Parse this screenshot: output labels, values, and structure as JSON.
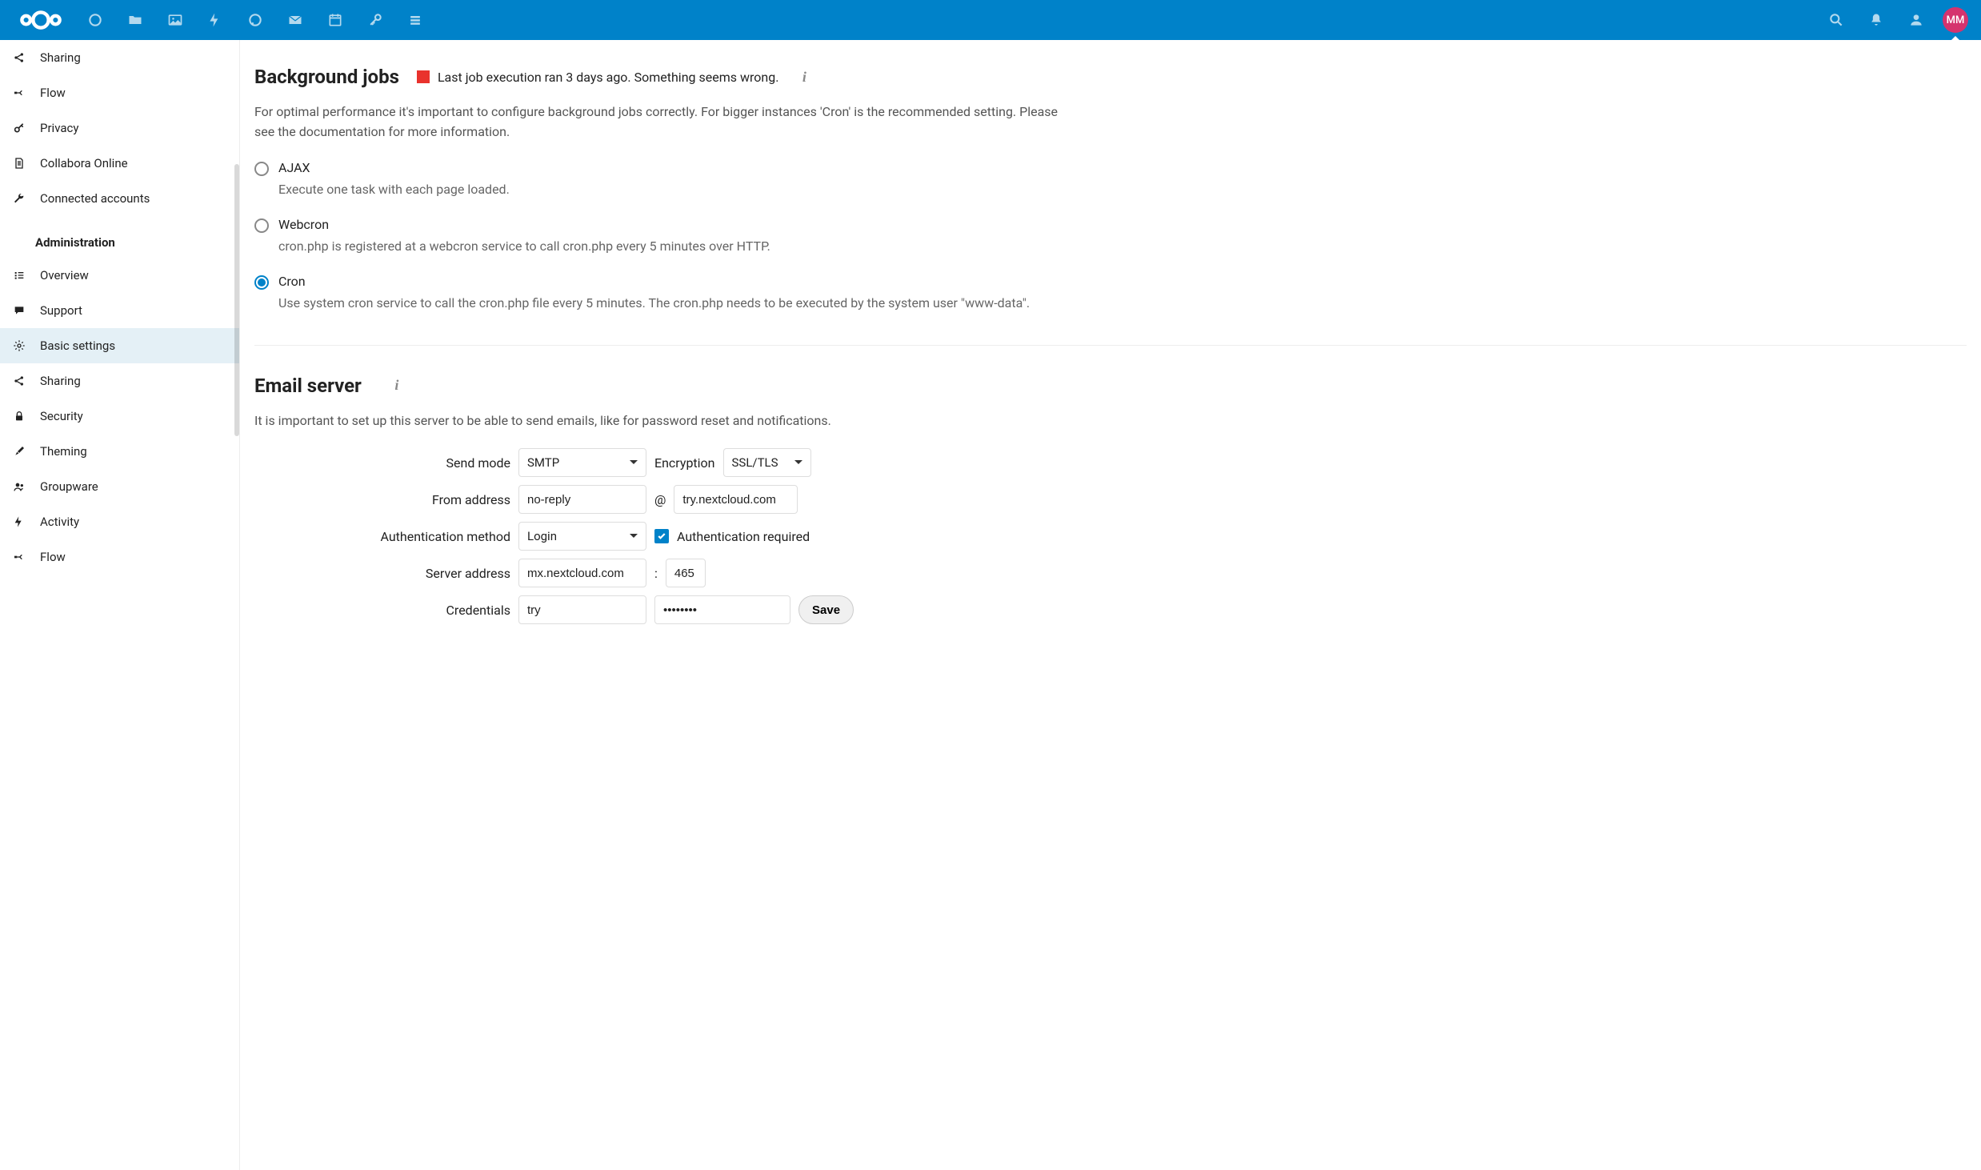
{
  "avatar_initials": "MM",
  "sidebar": {
    "personal": [
      {
        "id": "sharing",
        "label": "Sharing",
        "icon": "share"
      },
      {
        "id": "flow",
        "label": "Flow",
        "icon": "flow"
      },
      {
        "id": "privacy",
        "label": "Privacy",
        "icon": "key"
      },
      {
        "id": "collabora",
        "label": "Collabora Online",
        "icon": "doc"
      },
      {
        "id": "connected",
        "label": "Connected accounts",
        "icon": "wrench"
      }
    ],
    "admin_heading": "Administration",
    "admin": [
      {
        "id": "overview",
        "label": "Overview",
        "icon": "list"
      },
      {
        "id": "support",
        "label": "Support",
        "icon": "comment"
      },
      {
        "id": "basic",
        "label": "Basic settings",
        "icon": "gear",
        "active": true
      },
      {
        "id": "sharing-admin",
        "label": "Sharing",
        "icon": "share"
      },
      {
        "id": "security",
        "label": "Security",
        "icon": "lock"
      },
      {
        "id": "theming",
        "label": "Theming",
        "icon": "brush"
      },
      {
        "id": "groupware",
        "label": "Groupware",
        "icon": "group"
      },
      {
        "id": "activity",
        "label": "Activity",
        "icon": "bolt"
      },
      {
        "id": "flow-admin",
        "label": "Flow",
        "icon": "flow"
      }
    ]
  },
  "bg_jobs": {
    "title": "Background jobs",
    "status": "Last job execution ran 3 days ago. Something seems wrong.",
    "desc": "For optimal performance it's important to configure background jobs correctly. For bigger instances 'Cron' is the recommended setting. Please see the documentation for more information.",
    "options": [
      {
        "id": "ajax",
        "label": "AJAX",
        "desc": "Execute one task with each page loaded.",
        "selected": false
      },
      {
        "id": "webcron",
        "label": "Webcron",
        "desc": "cron.php is registered at a webcron service to call cron.php every 5 minutes over HTTP.",
        "selected": false
      },
      {
        "id": "cron",
        "label": "Cron",
        "desc": "Use system cron service to call the cron.php file every 5 minutes. The cron.php needs to be executed by the system user \"www-data\".",
        "selected": true
      }
    ]
  },
  "email": {
    "title": "Email server",
    "desc": "It is important to set up this server to be able to send emails, like for password reset and notifications.",
    "labels": {
      "send_mode": "Send mode",
      "encryption": "Encryption",
      "from_address": "From address",
      "auth_method": "Authentication method",
      "auth_required": "Authentication required",
      "server_address": "Server address",
      "credentials": "Credentials",
      "save": "Save"
    },
    "values": {
      "send_mode": "SMTP",
      "encryption": "SSL/TLS",
      "from_local": "no-reply",
      "from_domain": "try.nextcloud.com",
      "auth_method": "Login",
      "server_host": "mx.nextcloud.com",
      "server_port": "465",
      "cred_user": "try",
      "cred_pass": "••••••••"
    },
    "separators": {
      "at": "@",
      "colon": ":"
    }
  }
}
